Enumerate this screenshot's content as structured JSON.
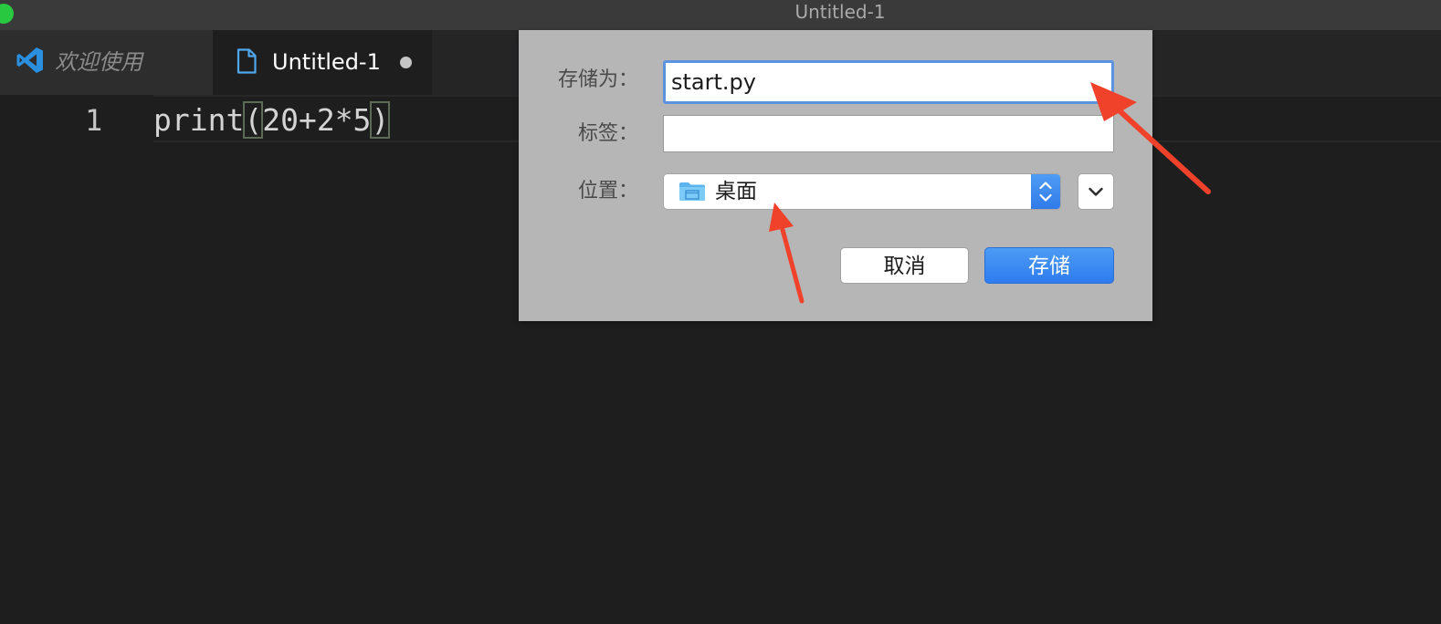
{
  "window": {
    "title": "Untitled-1"
  },
  "tabs": [
    {
      "label": "欢迎使用",
      "icon": "vscode-logo-icon",
      "active": false
    },
    {
      "label": "Untitled-1",
      "icon": "file-icon",
      "active": true,
      "unsaved": true
    }
  ],
  "editor": {
    "line_number": "1",
    "code": {
      "prefix": "print",
      "open_paren": "(",
      "expression": "20+2*5",
      "close_paren": ")"
    }
  },
  "save_dialog": {
    "save_as_label": "存储为：",
    "save_as_value": "start.py",
    "tags_label": "标签：",
    "tags_value": "",
    "location_label": "位置：",
    "location_value": "桌面",
    "location_icon": "folder-icon",
    "cancel_label": "取消",
    "save_label": "存储"
  },
  "colors": {
    "editor_background": "#1e1e1e",
    "dialog_background": "#b6b6b6",
    "accent_blue": "#2e7cee",
    "annotation_red": "#f0412a"
  }
}
